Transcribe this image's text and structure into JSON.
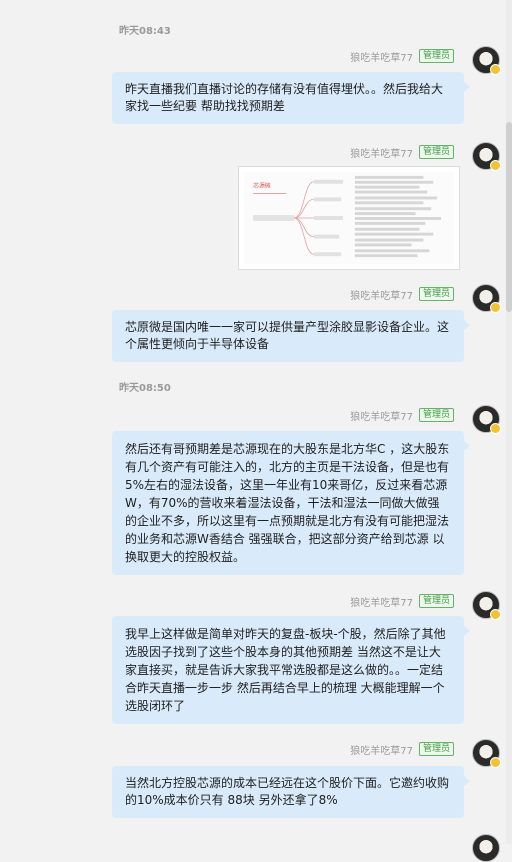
{
  "sender_name": "狼吃羊吃草77",
  "badge_label": "管理员",
  "timestamps": [
    "昨天08:43",
    "昨天08:50"
  ],
  "messages": [
    {
      "text": "昨天直播我们直播讨论的存储有没有值得埋伏。。然后我给大家找一些纪要 帮助找找预期差"
    },
    {
      "type": "image",
      "image_title": "芯源微"
    },
    {
      "text": "芯原微是国内唯一一家可以提供量产型涂胶显影设备企业。这个属性更倾向于半导体设备"
    },
    {
      "text": "然后还有哥预期差是芯源现在的大股东是北方华C ，这大股东有几个资产有可能注入的，北方的主页是干法设备，但是也有5%左右的湿法设备，这里一年业有10来哥亿，反过来看芯源W，有70%的营收来着湿法设备，干法和湿法一同做大做强的企业不多，所以这里有一点预期就是北方有没有可能把湿法的业务和芯源W香结合 强强联合，把这部分资产给到芯源 以换取更大的控股权益。"
    },
    {
      "text": "我早上这样做是简单对昨天的复盘-板块-个股，然后除了其他选股因子找到了这些个股本身的其他预期差 当然这不是让大家直接买，就是告诉大家我平常选股都是这么做的。。一定结合昨天直播一步一步 然后再结合早上的梳理 大概能理解一个选股闭环了"
    },
    {
      "text": "当然北方控股芯源的成本已经远在这个股价下面。它邀约收购的10%成本价只有 88块  另外还拿了8%"
    }
  ],
  "colors": {
    "bubble": "#d9ebfb",
    "badge": "#3f9b3f",
    "background": "#f2f2f2"
  },
  "icons": [
    "avatar",
    "verified-badge-icon"
  ]
}
